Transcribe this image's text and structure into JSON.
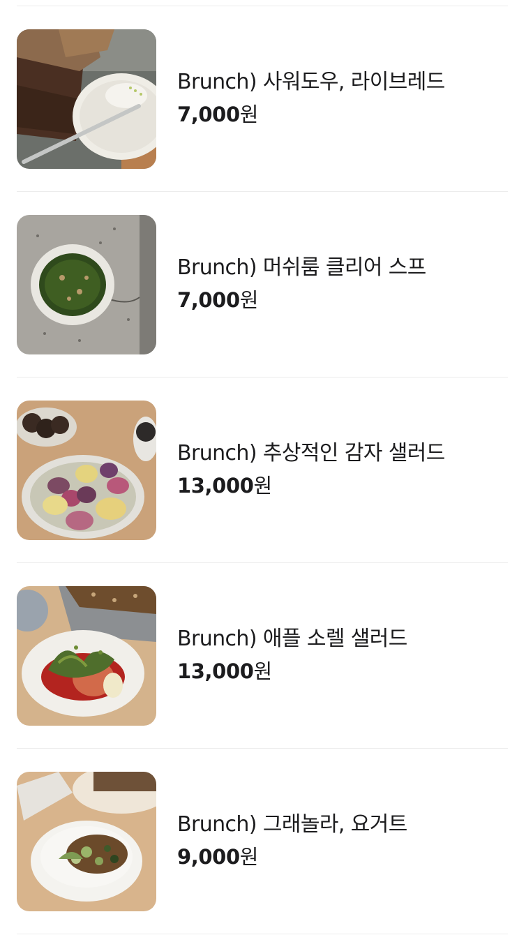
{
  "menu": {
    "items": [
      {
        "name": "Brunch) 사워도우, 라이브레드",
        "price": "7,000",
        "currency": "원",
        "image_icon": "sourdough-bread-photo"
      },
      {
        "name": "Brunch) 머쉬룸 클리어 스프",
        "price": "7,000",
        "currency": "원",
        "image_icon": "mushroom-soup-photo"
      },
      {
        "name": "Brunch) 추상적인 감자 샐러드",
        "price": "13,000",
        "currency": "원",
        "image_icon": "potato-salad-photo"
      },
      {
        "name": "Brunch) 애플 소렐 샐러드",
        "price": "13,000",
        "currency": "원",
        "image_icon": "apple-sorrel-salad-photo"
      },
      {
        "name": "Brunch) 그래놀라, 요거트",
        "price": "9,000",
        "currency": "원",
        "image_icon": "granola-yogurt-photo"
      }
    ]
  }
}
